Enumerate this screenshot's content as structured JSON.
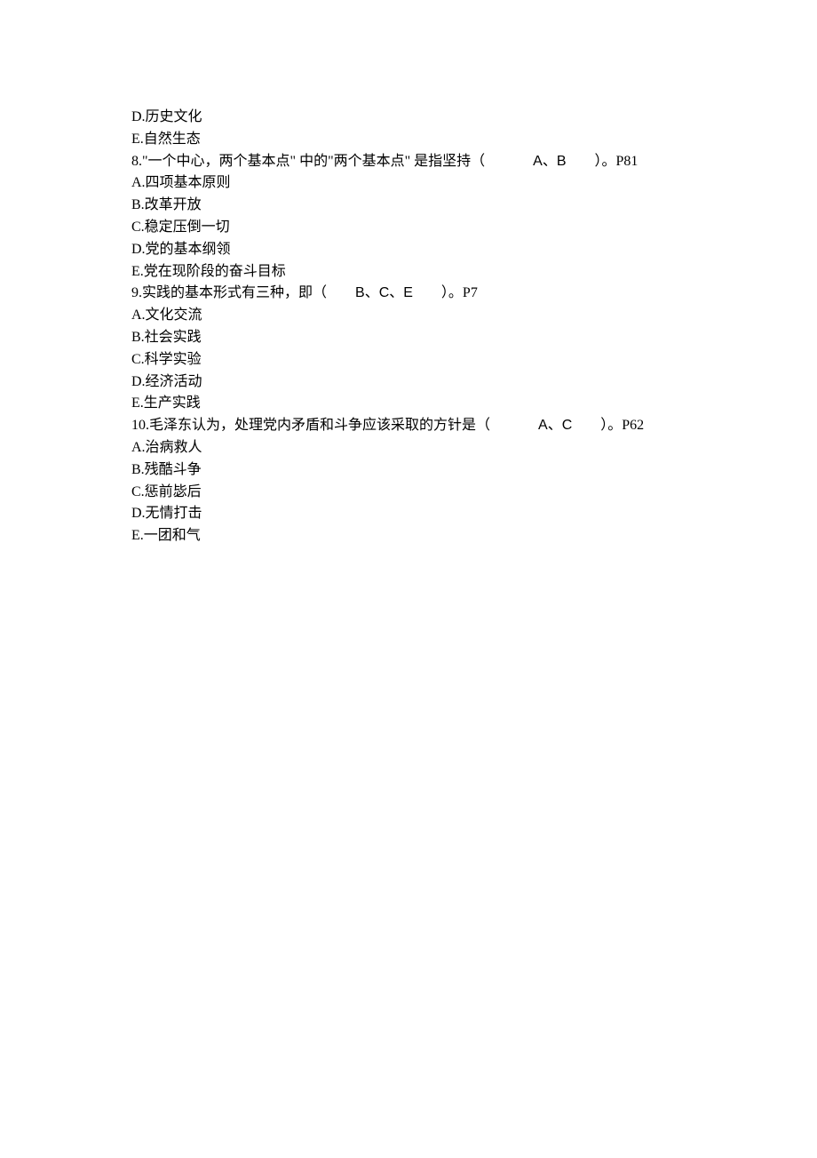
{
  "q7": {
    "optD": "D.历史文化",
    "optE": "E.自然生态"
  },
  "q8": {
    "stem_pre": "8.\"一个中心，两个基本点\" 中的\"两个基本点\" 是指坚持（",
    "answer": "A、B",
    "stem_post": "）。P81",
    "optA": "A.四项基本原则",
    "optB": "B.改革开放",
    "optC": "C.稳定压倒一切",
    "optD": "D.党的基本纲领",
    "optE": "E.党在现阶段的奋斗目标"
  },
  "q9": {
    "stem_pre": "9.实践的基本形式有三种，即（",
    "answer": "B、C、E",
    "stem_post": "）。P7",
    "optA": "A.文化交流",
    "optB": "B.社会实践",
    "optC": "C.科学实验",
    "optD": "D.经济活动",
    "optE": "E.生产实践"
  },
  "q10": {
    "stem_pre": "10.毛泽东认为，处理党内矛盾和斗争应该采取的方针是（",
    "answer": "A、C",
    "stem_post": "）。P62",
    "optA": "A.治病救人",
    "optB": "B.残酷斗争",
    "optC": "C.惩前毖后",
    "optD": "D.无情打击",
    "optE": "E.一团和气"
  }
}
